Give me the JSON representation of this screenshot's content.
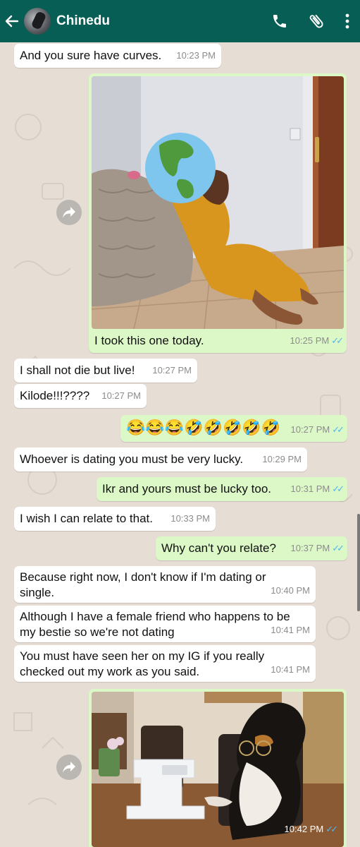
{
  "header": {
    "contact_name": "Chinedu"
  },
  "icons": {
    "back": "arrow-left-icon",
    "call": "phone-icon",
    "attach": "paperclip-icon",
    "menu": "more-vertical-icon",
    "forward": "forward-icon",
    "read": "double-check-icon"
  },
  "colors": {
    "header": "#075e54",
    "incoming": "#ffffff",
    "outgoing": "#dcf8c6",
    "read_ticks": "#4fb6ec"
  },
  "messages": [
    {
      "dir": "in",
      "text": "And you sure have curves.",
      "time": "10:23 PM"
    },
    {
      "dir": "out",
      "type": "image",
      "caption": "I took this one today.",
      "time": "10:25 PM"
    },
    {
      "dir": "in",
      "text": "I shall not die but live!",
      "time": "10:27 PM"
    },
    {
      "dir": "in",
      "text": "Kilode!!!????",
      "time": "10:27 PM"
    },
    {
      "dir": "out",
      "text": "😂😂😂🤣🤣🤣🤣🤣",
      "time": "10:27 PM"
    },
    {
      "dir": "in",
      "text": "Whoever is dating you must be very lucky.",
      "time": "10:29 PM"
    },
    {
      "dir": "out",
      "text": "Ikr and yours must be lucky too.",
      "time": "10:31 PM"
    },
    {
      "dir": "in",
      "text": "I wish I can relate to that.",
      "time": "10:33 PM"
    },
    {
      "dir": "out",
      "text": "Why can't you relate?",
      "time": "10:37 PM"
    },
    {
      "dir": "in",
      "text": "Because right now, I don't know if I'm dating or single.",
      "time": "10:40 PM"
    },
    {
      "dir": "in",
      "text": "Although I have a female friend who happens to be my bestie so we're not dating",
      "time": "10:41 PM"
    },
    {
      "dir": "in",
      "text": "You must have seen her on my IG if you really checked out my work as you said.",
      "time": "10:41 PM"
    },
    {
      "dir": "out",
      "type": "image",
      "caption": "",
      "time": "10:42 PM"
    }
  ]
}
